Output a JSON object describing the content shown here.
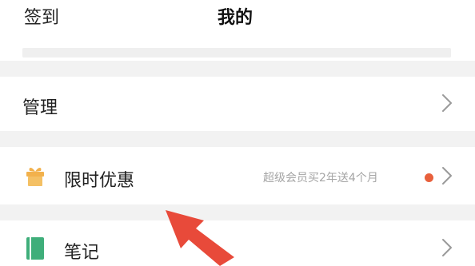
{
  "header": {
    "left_label": "签到",
    "title": "我的"
  },
  "menu": {
    "manage": {
      "label": "管理",
      "icon": "chevron-right-icon"
    },
    "promo": {
      "label": "限时优惠",
      "note": "超级会员买2年送4个月",
      "icon": "gift-icon",
      "badge_color": "#e8603c",
      "icon_color": "#f2b14c"
    },
    "notes": {
      "label": "笔记",
      "icon": "notebook-icon",
      "icon_color": "#3fae7a"
    }
  },
  "annotation": {
    "icon": "red-arrow-icon",
    "color": "#e84a3a"
  }
}
